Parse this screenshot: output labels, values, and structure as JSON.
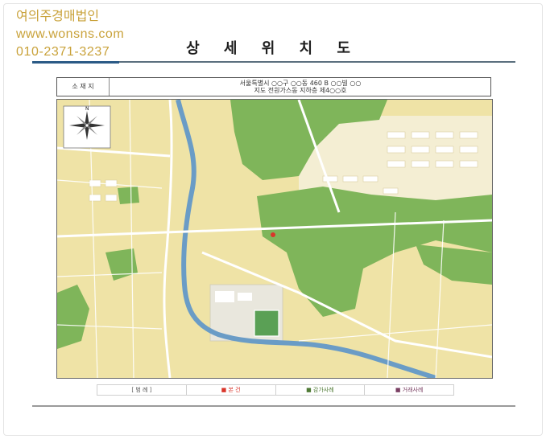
{
  "watermark": {
    "line1": "여의주경매법인",
    "line2": "www.wonsns.com",
    "line3": "010-2371-3237"
  },
  "title": "상 세 위 치 도",
  "address": {
    "label": "소 재 지",
    "line1": "서울특별시 ○○구 ○○동 460 B ○○빌 ○○",
    "line2": "지도 전원가스동 지하층 제4○○호"
  },
  "map": {
    "compass_label": "N",
    "colors": {
      "park": "#7fb55a",
      "urban": "#efe3a6",
      "river": "#6a9cc6",
      "road": "#ffffff",
      "block": "#f7f1cf"
    }
  },
  "legend": [
    {
      "label": "[ 범 례 ]",
      "color": ""
    },
    {
      "label": "■ 본 건",
      "color": "#d9362b"
    },
    {
      "label": "■ 감가사례",
      "color": "#4f7a35"
    },
    {
      "label": "■ 거래사례",
      "color": "#7a3f63"
    }
  ]
}
